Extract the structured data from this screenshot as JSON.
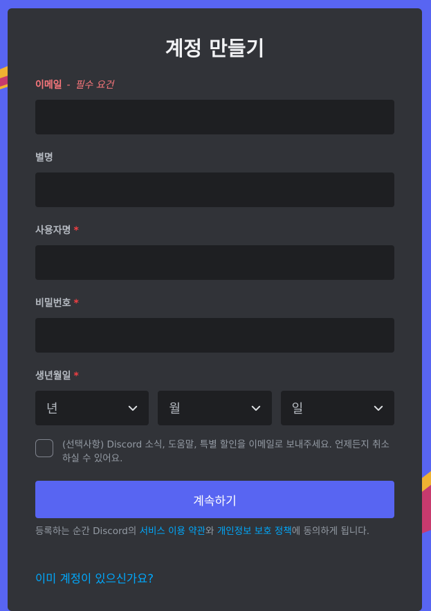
{
  "title": "계정 만들기",
  "email": {
    "label": "이메일",
    "separator": "-",
    "required_text": "필수 요건",
    "value": ""
  },
  "nickname": {
    "label": "별명",
    "value": ""
  },
  "username": {
    "label": "사용자명",
    "required_mark": "*",
    "value": ""
  },
  "password": {
    "label": "비밀번호",
    "required_mark": "*",
    "value": ""
  },
  "birthdate": {
    "label": "생년월일",
    "required_mark": "*",
    "year_placeholder": "년",
    "month_placeholder": "월",
    "day_placeholder": "일"
  },
  "marketing_opt_in": {
    "text": "(선택사항) Discord 소식, 도움말, 특별 할인을 이메일로 보내주세요. 언제든지 취소하실 수 있어요.",
    "checked": false
  },
  "continue_button": "계속하기",
  "terms": {
    "prefix": "등록하는 순간 Discord의 ",
    "tos_link": "서비스 이용 약관",
    "middle": "와 ",
    "privacy_link": "개인정보 보호 정책",
    "suffix": "에 동의하게 됩니다."
  },
  "login_link": "이미 계정이 있으신가요?",
  "colors": {
    "brand": "#5865f2",
    "card": "#313338",
    "input": "#1e1f22",
    "error": "#fa777c",
    "link": "#00a8fc"
  }
}
